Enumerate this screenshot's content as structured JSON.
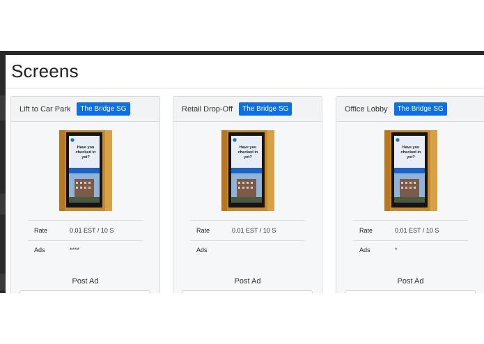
{
  "page": {
    "title": "Screens"
  },
  "colors": {
    "badge": "#0a6fe8",
    "card_bg": "#f6f7f8",
    "frame": "#2a2a2a"
  },
  "screens": [
    {
      "name": "Lift to Car Park",
      "badge": "The Bridge SG",
      "rate_label": "Rate",
      "rate": "0.01 EST / 10 S",
      "ads_label": "Ads",
      "ads": "****",
      "post_label": "Post Ad"
    },
    {
      "name": "Retail Drop-Off",
      "badge": "The Bridge SG",
      "rate_label": "Rate",
      "rate": "0.01 EST / 10 S",
      "ads_label": "Ads",
      "ads": "",
      "post_label": "Post Ad"
    },
    {
      "name": "Office Lobby",
      "badge": "The Bridge SG",
      "rate_label": "Rate",
      "rate": "0.01 EST / 10 S",
      "ads_label": "Ads",
      "ads": "*",
      "post_label": "Post Ad"
    }
  ],
  "screen_image": {
    "headline": "Have you checked in yet?"
  }
}
